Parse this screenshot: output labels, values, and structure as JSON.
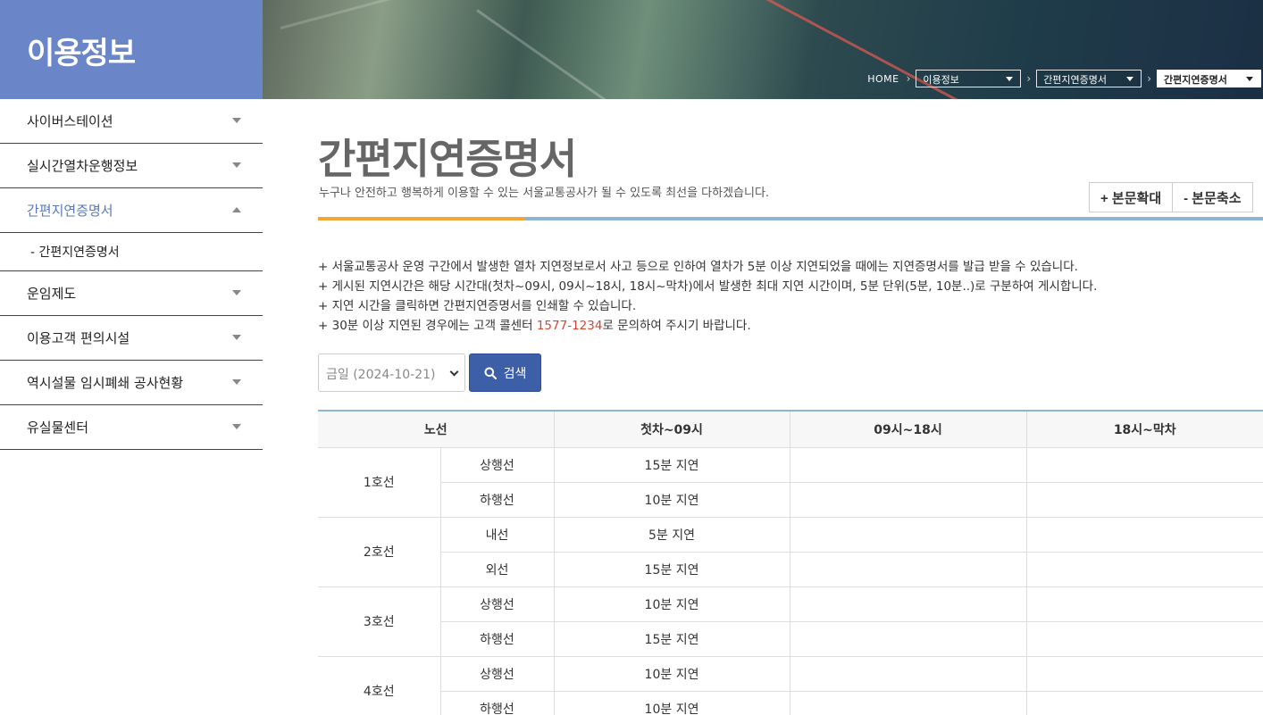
{
  "section": {
    "title": "이용정보"
  },
  "breadcrumb": {
    "home": "HOME",
    "level1": "이용정보",
    "level2": "간편지연증명서",
    "level3": "간편지연증명서"
  },
  "sidebar": {
    "items": [
      {
        "label": "사이버스테이션"
      },
      {
        "label": "실시간열차운행정보"
      },
      {
        "label": "간편지연증명서"
      },
      {
        "label": "운임제도"
      },
      {
        "label": "이용고객 편의시설"
      },
      {
        "label": "역시설물 임시폐쇄 공사현황"
      },
      {
        "label": "유실물센터"
      }
    ],
    "sub_item": "- 간편지연증명서"
  },
  "page": {
    "title": "간편지연증명서",
    "subtitle": "누구나 안전하고 행복하게 이용할 수 있는 서울교통공사가 될 수 있도록 최선을 다하겠습니다.",
    "zoom_in": "+ 본문확대",
    "zoom_out": "- 본문축소"
  },
  "notes": {
    "line1": "+ 서울교통공사 운영 구간에서 발생한 열차 지연정보로서 사고 등으로 인하여 열차가 5분 이상 지연되었을 때에는 지연증명서를 발급 받을 수 있습니다.",
    "line2": "+ 게시된 지연시간은 해당 시간대(첫차~09시, 09시~18시, 18시~막차)에서 발생한 최대 지연 시간이며, 5분 단위(5분, 10분..)로 구분하여 게시합니다.",
    "line3": "+ 지연 시간을 클릭하면 간편지연증명서를 인쇄할 수 있습니다.",
    "line4_pre": "+ 30분 이상 지연된 경우에는 고객 콜센터 ",
    "line4_phone": "1577-1234",
    "line4_post": "로 문의하여 주시기 바랍니다."
  },
  "filter": {
    "date_value": "금일 (2024-10-21)",
    "search_label": "검색"
  },
  "table": {
    "headers": {
      "line": "노선",
      "t1": "첫차~09시",
      "t2": "09시~18시",
      "t3": "18시~막차"
    },
    "groups": [
      {
        "line": "1호선",
        "rows": [
          {
            "dir": "상행선",
            "t1": "15분 지연",
            "t2": "",
            "t3": ""
          },
          {
            "dir": "하행선",
            "t1": "10분 지연",
            "t2": "",
            "t3": ""
          }
        ]
      },
      {
        "line": "2호선",
        "rows": [
          {
            "dir": "내선",
            "t1": "5분 지연",
            "t2": "",
            "t3": ""
          },
          {
            "dir": "외선",
            "t1": "15분 지연",
            "t2": "",
            "t3": ""
          }
        ]
      },
      {
        "line": "3호선",
        "rows": [
          {
            "dir": "상행선",
            "t1": "10분 지연",
            "t2": "",
            "t3": ""
          },
          {
            "dir": "하행선",
            "t1": "15분 지연",
            "t2": "",
            "t3": ""
          }
        ]
      },
      {
        "line": "4호선",
        "rows": [
          {
            "dir": "상행선",
            "t1": "10분 지연",
            "t2": "",
            "t3": ""
          },
          {
            "dir": "하행선",
            "t1": "10분 지연",
            "t2": "",
            "t3": ""
          }
        ]
      }
    ]
  },
  "colors": {
    "accent": "#6a86c8",
    "button": "#3d5fa8",
    "highlight": "#d9452f",
    "rule_orange": "#f3a638",
    "rule_blue": "#8eb4d3"
  }
}
